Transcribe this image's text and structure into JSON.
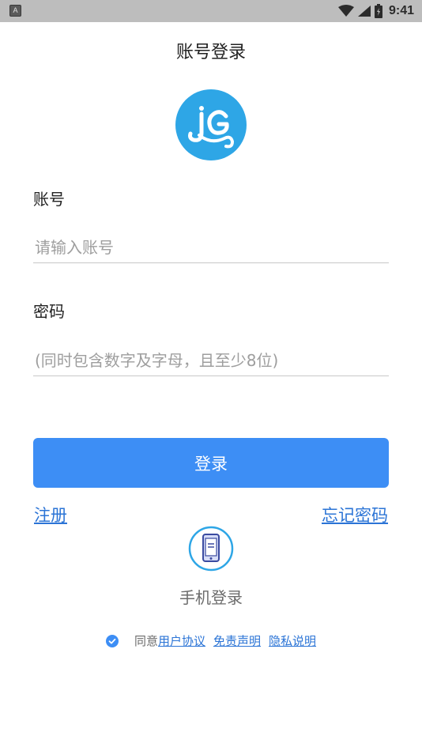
{
  "status_bar": {
    "app_icon_letter": "A",
    "time": "9:41"
  },
  "header": {
    "title": "账号登录"
  },
  "logo": {
    "brand_color": "#2ea6e6"
  },
  "form": {
    "account_label": "账号",
    "account_placeholder": "请输入账号",
    "password_label": "密码",
    "password_placeholder": "(同时包含数字及字母，且至少8位)",
    "login_button": "登录"
  },
  "links": {
    "register": "注册",
    "forgot_password": "忘记密码"
  },
  "phone_login": {
    "label": "手机登录"
  },
  "agreement": {
    "checked": true,
    "prefix": "同意",
    "user_agreement": "用户协议",
    "disclaimer": "免责声明",
    "privacy": "隐私说明"
  },
  "colors": {
    "accent": "#3d8ef5",
    "link": "#2b74d6"
  }
}
